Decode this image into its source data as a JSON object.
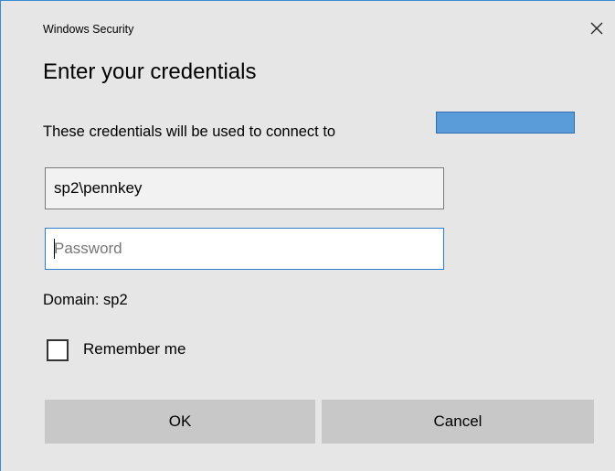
{
  "window": {
    "title": "Windows Security",
    "close_icon": "close-icon"
  },
  "heading": "Enter your credentials",
  "description": "These credentials will be used to connect to",
  "redacted_color": "#5a9bd9",
  "username_field": {
    "value": "sp2\\pennkey"
  },
  "password_field": {
    "value": "",
    "placeholder": "Password"
  },
  "domain_text": "Domain: sp2",
  "remember_me": {
    "label": "Remember me",
    "checked": false
  },
  "buttons": {
    "ok": "OK",
    "cancel": "Cancel"
  },
  "colors": {
    "accent": "#2d7dd2",
    "background": "#e6e6e6",
    "button": "#c8c8c8"
  }
}
